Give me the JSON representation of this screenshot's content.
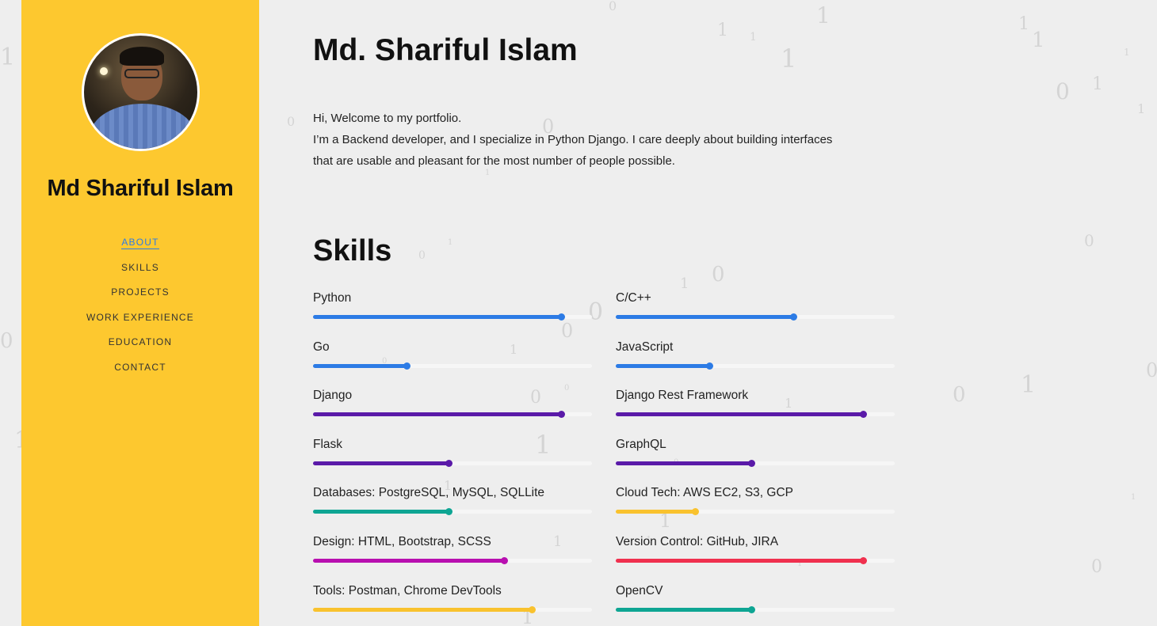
{
  "sidebar": {
    "name": "Md Shariful Islam",
    "nav": [
      "ABOUT",
      "SKILLS",
      "PROJECTS",
      "WORK EXPERIENCE",
      "EDUCATION",
      "CONTACT"
    ],
    "active": "ABOUT"
  },
  "about": {
    "title": "Md. Shariful Islam",
    "welcome": "Hi, Welcome to my portfolio.",
    "intro": "I’m a Backend developer, and I specialize in Python Django. I care deeply about building interfaces that are usable and pleasant for the most number of people possible."
  },
  "skills_section": {
    "title": "Skills",
    "items": [
      {
        "label": "Python",
        "level": 0.89,
        "color": "#2c7be5"
      },
      {
        "label": "C/C++",
        "level": 0.635,
        "color": "#2c7be5"
      },
      {
        "label": "Go",
        "level": 0.335,
        "color": "#2c7be5"
      },
      {
        "label": "JavaScript",
        "level": 0.335,
        "color": "#2c7be5"
      },
      {
        "label": "Django",
        "level": 0.89,
        "color": "#5a1aa8"
      },
      {
        "label": "Django Rest Framework",
        "level": 0.885,
        "color": "#5a1aa8"
      },
      {
        "label": "Flask",
        "level": 0.485,
        "color": "#5a1aa8"
      },
      {
        "label": "GraphQL",
        "level": 0.485,
        "color": "#5a1aa8"
      },
      {
        "label": "Databases: PostgreSQL, MySQL, SQLLite",
        "level": 0.485,
        "color": "#0ea593"
      },
      {
        "label": "Cloud Tech: AWS EC2, S3, GCP",
        "level": 0.285,
        "color": "#f9c22e"
      },
      {
        "label": "Design: HTML, Bootstrap, SCSS",
        "level": 0.685,
        "color": "#b80fb0"
      },
      {
        "label": "Version Control: GitHub, JIRA",
        "level": 0.885,
        "color": "#f0304e"
      },
      {
        "label": "Tools: Postman, Chrome DevTools",
        "level": 0.785,
        "color": "#f9c22e"
      },
      {
        "label": "OpenCV",
        "level": 0.485,
        "color": "#0ea593"
      }
    ]
  },
  "background_digits": [
    "0",
    "1"
  ]
}
